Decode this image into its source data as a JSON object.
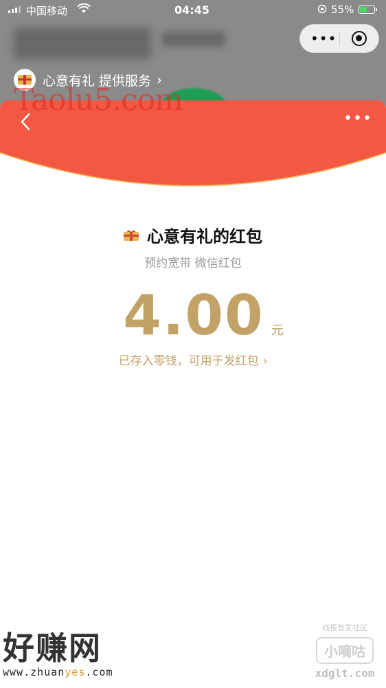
{
  "status_bar": {
    "carrier": "中国移动",
    "time": "04:45",
    "battery_percent": "55%",
    "battery_level": 0.55
  },
  "background_app": {
    "provider": "心意有礼 提供服务",
    "watermark": "Taolu5.com"
  },
  "capsule": {
    "more_icon": "more-dots-icon",
    "close_icon": "target-icon"
  },
  "red_packet": {
    "sender_name": "心意有礼的红包",
    "subtitle": "预约宽带 微信红包",
    "amount": "4.00",
    "unit": "元",
    "wallet_text": "已存入零钱，可用于发红包",
    "wallet_chevron": "›",
    "colors": {
      "red": "#f25844",
      "gold": "#c2a267"
    }
  },
  "watermarks": {
    "left_title": "好赚网",
    "left_url_prefix": "www.zhuan",
    "left_url_highlight": "yes",
    "left_url_suffix": ".com",
    "right_top": "线报首发社区",
    "right_badge": "小嘀咕",
    "right_url": "xdglt.com"
  }
}
